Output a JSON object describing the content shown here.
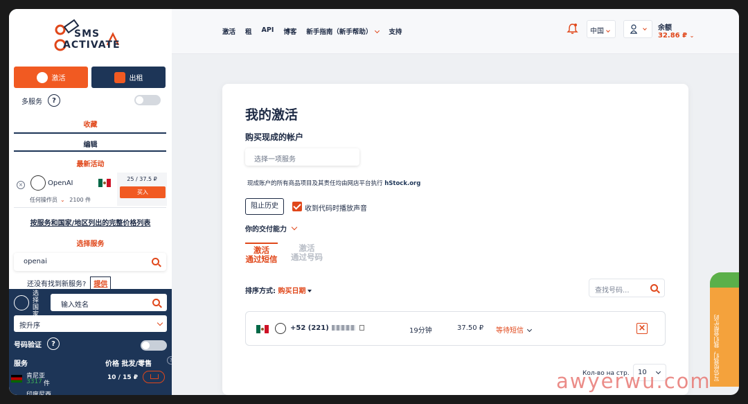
{
  "sidebar": {
    "logo": {
      "line1": "SMS",
      "line2": "ACTIVATE"
    },
    "tabs": {
      "activate": "激活",
      "rent": "出租"
    },
    "multi_service": "多服务",
    "favorites": "收藏",
    "edit": "编辑",
    "latest": "最新活动",
    "promo": {
      "name": "OpenAI",
      "price": "25 / 37.5 ₽",
      "buy": "买入",
      "operator": "任何操作员",
      "count": "2100 件"
    },
    "full_price_list": "按服务和国家/地区列出的完整价格列表",
    "choose_service": "选择服务",
    "service_search_value": "openai",
    "not_found": "还没有找到新服务?",
    "suggest": "提供",
    "country_vertical": "选择国家",
    "name_placeholder": "输入姓名",
    "sort_value": "按升序",
    "number_verification": "号码验证",
    "table_head": {
      "service": "服务",
      "price": "价格 批发/零售"
    },
    "rows": [
      {
        "country": "肯尼亚",
        "count": "3317",
        "unit": "件",
        "price": "10 / 15 ₽"
      }
    ],
    "next_row": "印度尼西"
  },
  "topbar": {
    "nav": [
      "激活",
      "租",
      "API",
      "博客",
      "新手指南（新手帮助）",
      "支持"
    ],
    "lang": "中国",
    "balance_label": "余额",
    "balance_value": "32.86 ₽"
  },
  "main": {
    "title": "我的激活",
    "buy_accounts": "购买现成的帐户",
    "service_placeholder": "选择一项服务",
    "note_prefix": "现成账户的所有商品项目及其责任均由网店平台执行 ",
    "note_link": "hStock.org",
    "history_button": "阻止历史",
    "play_sound": "收到代码时播放声音",
    "payment_capacity": "你的交付能力",
    "tabs": [
      {
        "line1": "激活",
        "line2": "通过短信"
      },
      {
        "line1": "激活",
        "line2": "通过号码"
      }
    ],
    "sort_label": "排序方式:",
    "sort_value": "购买日期",
    "number_search_placeholder": "查找号码...",
    "order": {
      "phone": "+52 (221)",
      "time": "19分钟",
      "price": "37.50 ₽",
      "status": "等待短信"
    },
    "per_page_label": "Кол-во на стр.",
    "per_page_value": "10"
  },
  "widget": {
    "support_text": "写信给我们，我们会帮忙的"
  },
  "watermark": "awyerwu.com",
  "colors": {
    "accent": "#f15a22",
    "navy": "#1d3557"
  }
}
